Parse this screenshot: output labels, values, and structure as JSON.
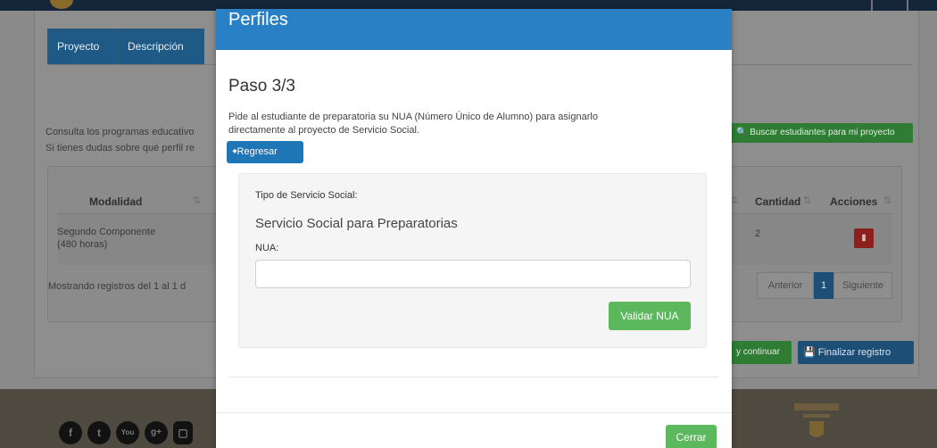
{
  "background": {
    "tabs": [
      "Proyecto",
      "Descripción"
    ],
    "info_line_1": "Consulta los programas educativo",
    "info_line_2": "Si tienes dudas sobre qué perfil re",
    "search_students_button": "Buscar estudiantes para mi proyecto",
    "table": {
      "headers": [
        "Modalidad",
        "Cantidad",
        "Acciones"
      ],
      "row": {
        "modalidad_line1": "Segundo Componente",
        "modalidad_line2": "(480 horas)",
        "cantidad": "2"
      },
      "footer_info": "Mostrando registros del 1 al 1 d"
    },
    "pagination": {
      "prev": "Anterior",
      "page": "1",
      "next": "Siguiente"
    },
    "continue_button": "y continuar",
    "finish_button": "Finalizar registro"
  },
  "modal": {
    "title": "Perfiles",
    "step": "Paso 3/3",
    "instruction_line1": "Pide al estudiante de preparatoria su NUA (Número Único de Alumno) para asignarlo",
    "instruction_line2": "directamente al proyecto de Servicio Social.",
    "back_button": "Regresar",
    "service_type_label": "Tipo de Servicio Social:",
    "service_type_value": "Servicio Social para Preparatorias",
    "nua_label": "NUA:",
    "nua_value": "",
    "validate_button": "Validar NUA",
    "close_button": "Cerrar"
  },
  "colors": {
    "modal_header": "#2a80c5",
    "primary_button": "#1e76b6",
    "success_button": "#5cb85c"
  }
}
